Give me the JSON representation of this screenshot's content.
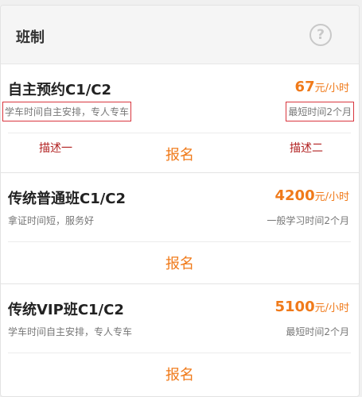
{
  "header": {
    "title": "班制",
    "help_glyph": "?"
  },
  "cards": [
    {
      "title": "自主预约C1/C2",
      "price": "67",
      "unit": "元/小时",
      "desc_left": "学车时间自主安排，专人专车",
      "desc_right": "最短时间2个月",
      "enroll_label": "报名"
    },
    {
      "title": "传统普通班C1/C2",
      "price": "4200",
      "unit": "元/小时",
      "desc_left": "拿证时间短，服务好",
      "desc_right": "一般学习时间2个月",
      "enroll_label": "报名"
    },
    {
      "title": "传统VIP班C1/C2",
      "price": "5100",
      "unit": "元/小时",
      "desc_left": "学车时间自主安排，专人专车",
      "desc_right": "最短时间2个月",
      "enroll_label": "报名"
    }
  ],
  "annotations": {
    "left": "描述一",
    "right": "描述二"
  },
  "colors": {
    "accent": "#f07a1a",
    "annotation": "#b22222",
    "annotation_box": "#d9363e"
  }
}
